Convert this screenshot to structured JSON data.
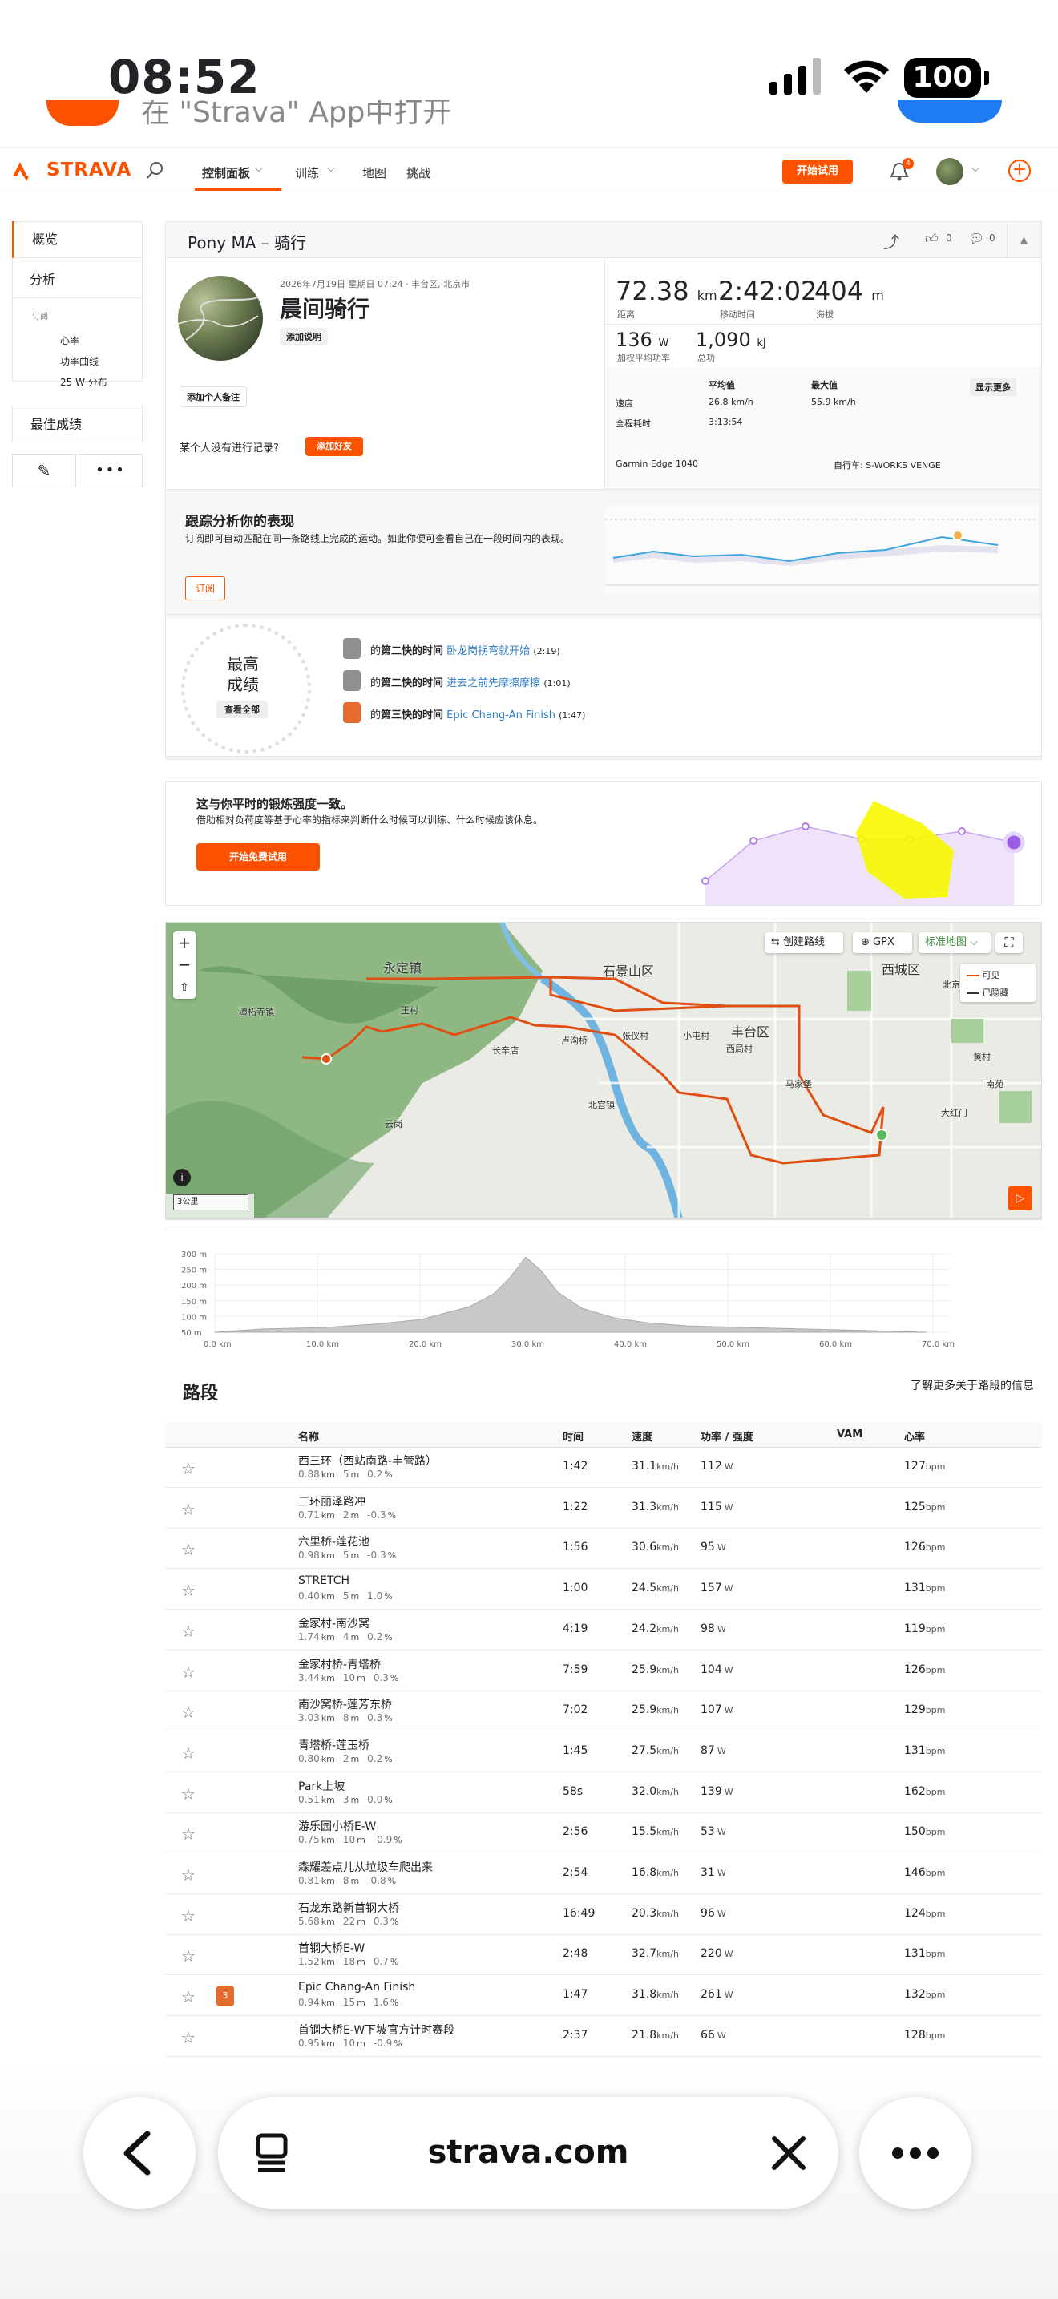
{
  "status": {
    "time": "08:52",
    "battery": "100"
  },
  "peek": {
    "text": "在 \"Strava\" App中打开"
  },
  "nav": {
    "logo": "STRAVA",
    "menu": [
      "控制面板",
      "训练",
      "地图",
      "挑战"
    ],
    "trial": "开始试用",
    "notif_count": "4"
  },
  "sidebar": {
    "items": [
      "概览",
      "分析"
    ],
    "sub_header": "订阅",
    "sub_items": [
      "心率",
      "功率曲线",
      "25 W 分布"
    ],
    "best": "最佳成绩"
  },
  "activity": {
    "header": "Pony MA – 骑行",
    "kudos": "0",
    "comments": "0",
    "date": "2026年7月19日 星期日 07:24 · 丰台区, 北京市",
    "title": "晨间骑行",
    "add_desc": "添加说明",
    "add_note": "添加个人备注",
    "friend_q": "某个人没有进行记录?",
    "add_friend": "添加好友"
  },
  "stats": {
    "distance": "72.38",
    "distance_unit": "km",
    "distance_label": "距离",
    "moving_time": "2:42:02",
    "moving_label": "移动时间",
    "elev": "404",
    "elev_unit": "m",
    "elev_label": "海拔",
    "power": "136",
    "power_unit": "W",
    "power_label": "加权平均功率",
    "total": "1,090",
    "total_unit": "kJ",
    "total_label": "总功",
    "avg_head": "平均值",
    "max_head": "最大值",
    "show_more": "显示更多",
    "speed_label": "速度",
    "avg_speed": "26.8 km/h",
    "max_speed": "55.9 km/h",
    "elapsed_label": "全程耗时",
    "elapsed": "3:13:54",
    "device": "Garmin Edge 1040",
    "bike": "自行车: S-WORKS VENGE"
  },
  "track": {
    "title": "跟踪分析你的表现",
    "desc": "订阅即可自动匹配在同一条路线上完成的运动。如此你便可查看自己在一段时间内的表现。",
    "btn": "订阅"
  },
  "best": {
    "badge_line1": "最高",
    "badge_line2": "成绩",
    "view_all": "查看全部",
    "items": [
      {
        "prefix": "的",
        "rank": "第二快的时间",
        "seg": "卧龙岗拐弯就开始",
        "time": "(2:19)",
        "medal": "2"
      },
      {
        "prefix": "的",
        "rank": "第二快的时间",
        "seg": "进去之前先摩擦摩擦",
        "time": "(1:01)",
        "medal": "2"
      },
      {
        "prefix": "的",
        "rank": "第三快的时间",
        "seg": "Epic Chang-An Finish",
        "time": "(1:47)",
        "medal": "3"
      }
    ]
  },
  "intensity": {
    "title": "这与你平时的锻炼强度一致。",
    "desc": "借助相对负荷度等基于心率的指标来判断什么时候可以训练、什么时候应该休息。",
    "btn": "开始免费试用"
  },
  "map": {
    "create_route": "创建路线",
    "gpx": "GPX",
    "style": "标准地图",
    "visible": "可见",
    "hidden": "已隐藏",
    "scale": "3公里",
    "places": [
      "永定镇",
      "石景山区",
      "西城区",
      "潭柘寺镇",
      "王村",
      "丰台区",
      "北宫镇",
      "卢沟桥",
      "北京",
      "黄村",
      "张仪村",
      "小屯村",
      "西局村",
      "马家堡",
      "南苑",
      "大红门",
      "长辛店",
      "云岗"
    ]
  },
  "elevation": {
    "yticks": [
      "300 m",
      "250 m",
      "200 m",
      "150 m",
      "100 m",
      "50 m"
    ],
    "xticks": [
      "0.0 km",
      "10.0 km",
      "20.0 km",
      "30.0 km",
      "40.0 km",
      "50.0 km",
      "60.0 km",
      "70.0 km"
    ]
  },
  "segments": {
    "title": "路段",
    "more": "了解更多关于路段的信息",
    "headers": [
      "名称",
      "时间",
      "速度",
      "功率 / 强度",
      "VAM",
      "心率"
    ],
    "rows": [
      {
        "name": "西三环（西站南路-丰管路）",
        "dist": "0.88",
        "gain": "5",
        "grade": "0.2",
        "time": "1:42",
        "speed": "31.1",
        "power": "112",
        "hr": "127"
      },
      {
        "name": "三环丽泽路冲",
        "dist": "0.71",
        "gain": "2",
        "grade": "-0.3",
        "time": "1:22",
        "speed": "31.3",
        "power": "115",
        "hr": "125"
      },
      {
        "name": "六里桥-莲花池",
        "dist": "0.98",
        "gain": "5",
        "grade": "-0.3",
        "time": "1:56",
        "speed": "30.6",
        "power": "95",
        "hr": "126"
      },
      {
        "name": "STRETCH",
        "dist": "0.40",
        "gain": "5",
        "grade": "1.0",
        "time": "1:00",
        "speed": "24.5",
        "power": "157",
        "hr": "131"
      },
      {
        "name": "金家村-南沙窝",
        "dist": "1.74",
        "gain": "4",
        "grade": "0.2",
        "time": "4:19",
        "speed": "24.2",
        "power": "98",
        "hr": "119"
      },
      {
        "name": "金家村桥-青塔桥",
        "dist": "3.44",
        "gain": "10",
        "grade": "0.3",
        "time": "7:59",
        "speed": "25.9",
        "power": "104",
        "hr": "126"
      },
      {
        "name": "南沙窝桥-莲芳东桥",
        "dist": "3.03",
        "gain": "8",
        "grade": "0.3",
        "time": "7:02",
        "speed": "25.9",
        "power": "107",
        "hr": "129"
      },
      {
        "name": "青塔桥-莲玉桥",
        "dist": "0.80",
        "gain": "2",
        "grade": "0.2",
        "time": "1:45",
        "speed": "27.5",
        "power": "87",
        "hr": "131"
      },
      {
        "name": "Park上坡",
        "dist": "0.51",
        "gain": "3",
        "grade": "0.0",
        "time": "58s",
        "speed": "32.0",
        "power": "139",
        "hr": "162"
      },
      {
        "name": "游乐园小桥E-W",
        "dist": "0.75",
        "gain": "10",
        "grade": "-0.9",
        "time": "2:56",
        "speed": "15.5",
        "power": "53",
        "hr": "150"
      },
      {
        "name": "森耀差点儿从垃圾车爬出来",
        "dist": "0.81",
        "gain": "8",
        "grade": "-0.8",
        "time": "2:54",
        "speed": "16.8",
        "power": "31",
        "hr": "146"
      },
      {
        "name": "石龙东路新首钢大桥",
        "dist": "5.68",
        "gain": "22",
        "grade": "0.3",
        "time": "16:49",
        "speed": "20.3",
        "power": "96",
        "hr": "124"
      },
      {
        "name": "首钢大桥E-W",
        "dist": "1.52",
        "gain": "18",
        "grade": "0.7",
        "time": "2:48",
        "speed": "32.7",
        "power": "220",
        "hr": "131"
      },
      {
        "name": "Epic Chang-An Finish",
        "dist": "0.94",
        "gain": "15",
        "grade": "1.6",
        "time": "1:47",
        "speed": "31.8",
        "power": "261",
        "hr": "132",
        "medal": "3"
      },
      {
        "name": "首钢大桥E-W下坡官方计时赛段",
        "dist": "0.95",
        "gain": "10",
        "grade": "-0.9",
        "time": "2:37",
        "speed": "21.8",
        "power": "66",
        "hr": "128"
      }
    ],
    "units": {
      "km": "km",
      "m": "m",
      "pct": "%",
      "kmh": "km/h",
      "w": "W",
      "bpm": "bpm"
    }
  },
  "browser": {
    "url": "strava.com"
  }
}
